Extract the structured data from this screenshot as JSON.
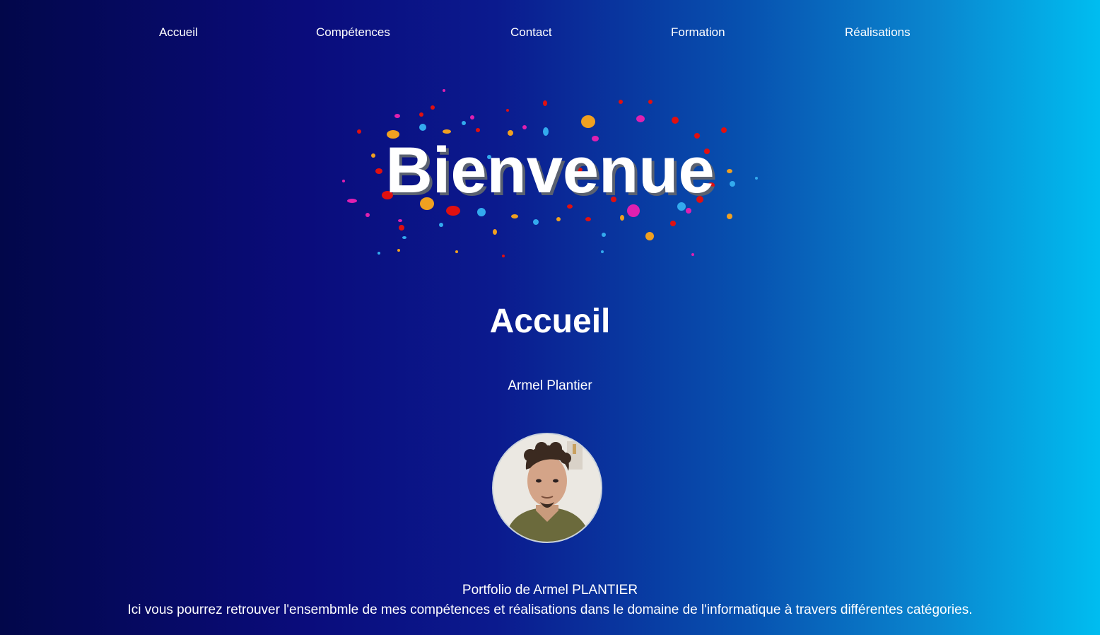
{
  "nav": {
    "items": [
      {
        "label": "Accueil"
      },
      {
        "label": "Compétences"
      },
      {
        "label": "Contact"
      },
      {
        "label": "Formation"
      },
      {
        "label": "Réalisations"
      }
    ]
  },
  "banner": {
    "text": "Bienvenue"
  },
  "main": {
    "title": "Accueil",
    "author": "Armel Plantier",
    "intro_line1": "Portfolio de Armel PLANTIER",
    "intro_line2": "Ici vous pourrez retrouver l'ensembmle de mes compétences et réalisations dans le domaine de l'informatique à travers différentes catégories."
  },
  "colors": {
    "gradient_left": "#02074a",
    "gradient_mid": "#0b1a8e",
    "gradient_right": "#00bdf0",
    "text": "#ffffff"
  }
}
